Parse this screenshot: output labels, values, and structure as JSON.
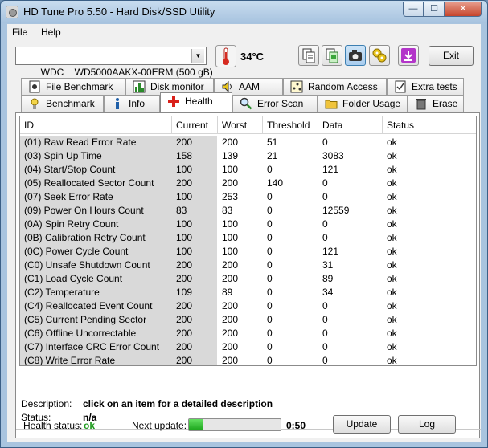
{
  "window": {
    "title": "HD Tune Pro 5.50 - Hard Disk/SSD Utility"
  },
  "menu": [
    {
      "label": "File"
    },
    {
      "label": "Help"
    }
  ],
  "toolbar": {
    "drive": "WDC    WD5000AAKX-00ERM (500 gB)",
    "temperature": "34°C",
    "exit_label": "Exit"
  },
  "tabs_top": [
    {
      "label": "File Benchmark",
      "icon": "file-benchmark-icon"
    },
    {
      "label": "Disk monitor",
      "icon": "disk-monitor-icon"
    },
    {
      "label": "AAM",
      "icon": "speaker-icon"
    },
    {
      "label": "Random Access",
      "icon": "random-access-icon"
    },
    {
      "label": "Extra tests",
      "icon": "extra-tests-icon"
    }
  ],
  "tabs_bottom": [
    {
      "label": "Benchmark",
      "icon": "benchmark-icon"
    },
    {
      "label": "Info",
      "icon": "info-icon"
    },
    {
      "label": "Health",
      "icon": "health-cross-icon"
    },
    {
      "label": "Error Scan",
      "icon": "magnifier-icon"
    },
    {
      "label": "Folder Usage",
      "icon": "folder-icon"
    },
    {
      "label": "Erase",
      "icon": "trash-icon"
    }
  ],
  "active_tab": "Health",
  "table": {
    "columns": [
      "ID",
      "Current",
      "Worst",
      "Threshold",
      "Data",
      "Status"
    ],
    "rows": [
      [
        "(01) Raw Read Error Rate",
        "200",
        "200",
        "51",
        "0",
        "ok"
      ],
      [
        "(03) Spin Up Time",
        "158",
        "139",
        "21",
        "3083",
        "ok"
      ],
      [
        "(04) Start/Stop Count",
        "100",
        "100",
        "0",
        "121",
        "ok"
      ],
      [
        "(05) Reallocated Sector Count",
        "200",
        "200",
        "140",
        "0",
        "ok"
      ],
      [
        "(07) Seek Error Rate",
        "100",
        "253",
        "0",
        "0",
        "ok"
      ],
      [
        "(09) Power On Hours Count",
        "83",
        "83",
        "0",
        "12559",
        "ok"
      ],
      [
        "(0A) Spin Retry Count",
        "100",
        "100",
        "0",
        "0",
        "ok"
      ],
      [
        "(0B) Calibration Retry Count",
        "100",
        "100",
        "0",
        "0",
        "ok"
      ],
      [
        "(0C) Power Cycle Count",
        "100",
        "100",
        "0",
        "121",
        "ok"
      ],
      [
        "(C0) Unsafe Shutdown Count",
        "200",
        "200",
        "0",
        "31",
        "ok"
      ],
      [
        "(C1) Load Cycle Count",
        "200",
        "200",
        "0",
        "89",
        "ok"
      ],
      [
        "(C2) Temperature",
        "109",
        "89",
        "0",
        "34",
        "ok"
      ],
      [
        "(C4) Reallocated Event Count",
        "200",
        "200",
        "0",
        "0",
        "ok"
      ],
      [
        "(C5) Current Pending Sector",
        "200",
        "200",
        "0",
        "0",
        "ok"
      ],
      [
        "(C6) Offline Uncorrectable",
        "200",
        "200",
        "0",
        "0",
        "ok"
      ],
      [
        "(C7) Interface CRC Error Count",
        "200",
        "200",
        "0",
        "0",
        "ok"
      ],
      [
        "(C8) Write Error Rate",
        "200",
        "200",
        "0",
        "0",
        "ok"
      ]
    ]
  },
  "description": {
    "label": "Description:",
    "value": "click on an item for a detailed description",
    "status_label": "Status:",
    "status_value": "n/a"
  },
  "footer": {
    "health_label": "Health status:",
    "health_value": "ok",
    "health_color": "#1d9a1d",
    "next_update_label": "Next update:",
    "timer": "0:50",
    "progress_fraction": 0.16,
    "update_label": "Update",
    "log_label": "Log"
  }
}
